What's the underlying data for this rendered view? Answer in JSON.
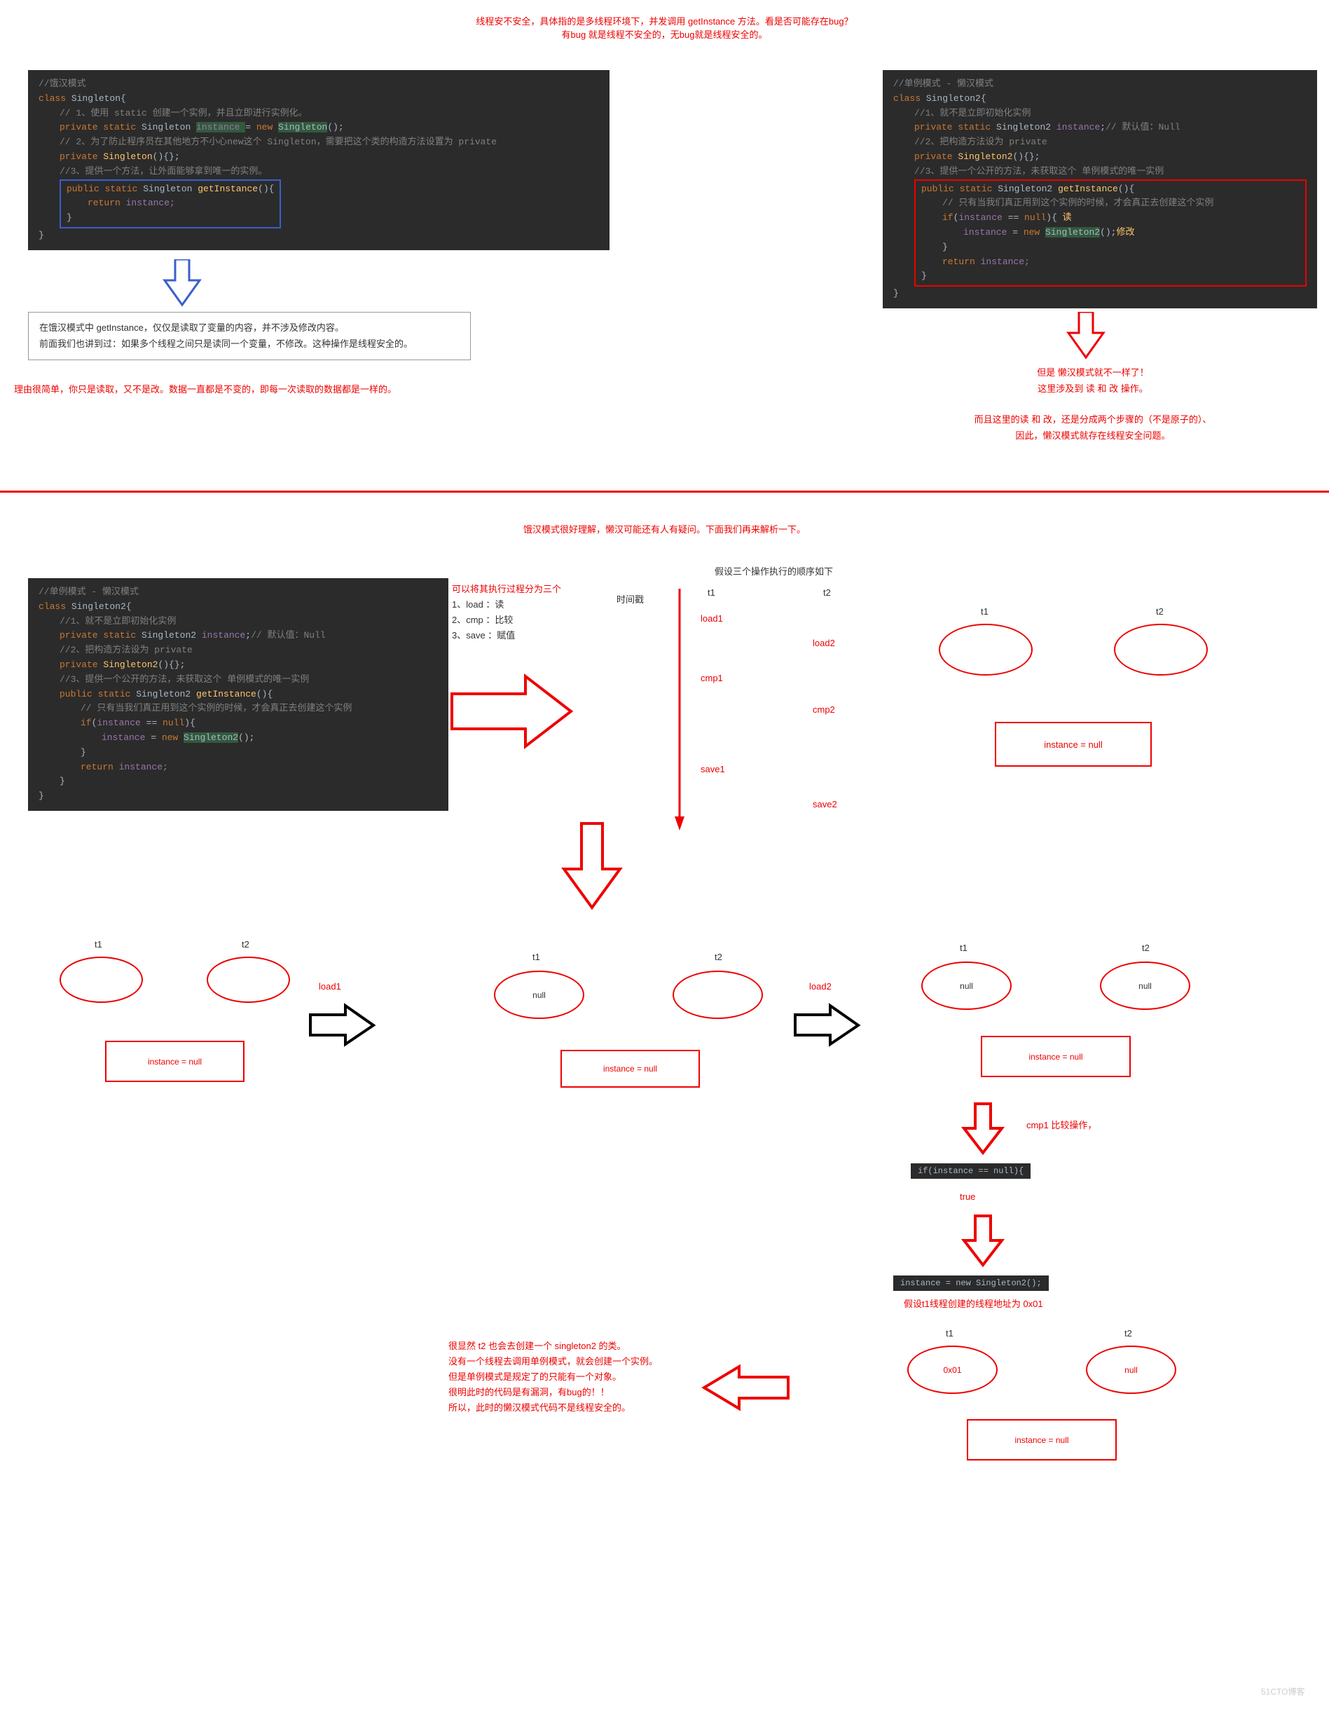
{
  "header": {
    "l1": "线程安不安全，具体指的是多线程环境下，并发调用 getInstance 方法。看是否可能存在bug？",
    "l2": "有bug 就是线程不安全的，无bug就是线程安全的。"
  },
  "code1": {
    "c0": "//饿汉模式",
    "c1a": "class ",
    "c1b": "Singleton",
    "c1c": "{",
    "c2": "// 1、使用 static 创建一个实例，并且立即进行实例化。",
    "c3a": "private ",
    "c3b": "static ",
    "c3c": "Singleton ",
    "c3d": "instance ",
    "c3e": "= ",
    "c3f": "new ",
    "c3g": "Singleton",
    "c3h": "();",
    "c4": "// 2、为了防止程序员在其他地方不小心new这个 Singleton，需要把这个类的构造方法设置为 private",
    "c5a": "private ",
    "c5b": "Singleton",
    "c5c": "(){};",
    "c6": "//3、提供一个方法，让外面能够拿到唯一的实例。",
    "c7a": "public static ",
    "c7b": "Singleton ",
    "c7c": "getInstance",
    "c7d": "(){",
    "c8a": "return ",
    "c8b": "instance;",
    "c9": "}",
    "c10": "}"
  },
  "code2": {
    "c0": "//单例模式 - 懒汉模式",
    "c1a": "class ",
    "c1b": "Singleton2",
    "c1c": "{",
    "c2": "//1、就不是立即初始化实例",
    "c3a": "private static ",
    "c3b": "Singleton2 ",
    "c3c": "instance",
    "c3d": ";",
    "c3e": "// 默认值：Null",
    "c4": "//2、把构造方法设为 private",
    "c5a": "private ",
    "c5b": "Singleton2",
    "c5c": "(){};",
    "c6": "//3、提供一个公开的方法，未获取这个 单例模式的唯一实例",
    "c7a": "public static ",
    "c7b": "Singleton2 ",
    "c7c": "getInstance",
    "c7d": "(){",
    "c8": "// 只有当我们真正用到这个实例的时候，才会真正去创建这个实例",
    "c9a": "if",
    "c9b": "(",
    "c9c": "instance ",
    "c9d": "== ",
    "c9e": "null",
    "c9f": "){ ",
    "c9g": "读",
    "c10a": "instance ",
    "c10b": "= ",
    "c10c": "new ",
    "c10d": "Singleton2",
    "c10e": "();",
    "c10f": "修改",
    "c11": "}",
    "c12a": "return ",
    "c12b": "instance;",
    "c13": "}",
    "c14": "}"
  },
  "box1": {
    "l1": "在饿汉模式中 getInstance，仅仅是读取了变量的内容，并不涉及修改内容。",
    "l2": "前面我们也讲到过：如果多个线程之间只是读同一个变量，不修改。这种操作是线程安全的。"
  },
  "reason1": "理由很简单，你只是读取，又不是改。数据一直都是不变的，即每一次读取的数据都是一样的。",
  "right_text": {
    "l1": "但是 懒汉模式就不一样了！",
    "l2": "这里涉及到 读 和 改 操作。",
    "l3": "而且这里的读 和 改，还是分成两个步骤的（不是原子的）、",
    "l4": "因此，懒汉模式就存在线程安全问题。"
  },
  "sec2_header": "饿汉模式很好理解，懒汉可能还有人有疑问。下面我们再来解析一下。",
  "code3": {
    "c0": "//单例模式 - 懒汉模式",
    "c1a": "class ",
    "c1b": "Singleton2",
    "c1c": "{",
    "c2": "//1、就不是立即初始化实例",
    "c3a": "private static ",
    "c3b": "Singleton2 ",
    "c3c": "instance",
    "c3d": ";",
    "c3e": "// 默认值：Null",
    "c4": "//2、把构造方法设为 private",
    "c5a": "private ",
    "c5b": "Singleton2",
    "c5c": "(){};",
    "c6": "//3、提供一个公开的方法，未获取这个 单例模式的唯一实例",
    "c7a": "public static ",
    "c7b": "Singleton2 ",
    "c7c": "getInstance",
    "c7d": "(){",
    "c8": "// 只有当我们真正用到这个实例的时候，才会真正去创建这个实例",
    "c9a": "if",
    "c9b": "(",
    "c9c": "instance ",
    "c9d": "== ",
    "c9e": "null",
    "c9f": "){",
    "c10a": "instance ",
    "c10b": "= ",
    "c10c": "new ",
    "c10d": "Singleton2",
    "c10e": "();",
    "c11": "}",
    "c12a": "return ",
    "c12b": "instance;",
    "c13": "}",
    "c14": "}"
  },
  "steps": {
    "title": "可以将其执行过程分为三个",
    "s1": "1、load ：读",
    "s2": "2、cmp ：比较",
    "s3": "3、save ：赋值"
  },
  "timeline": {
    "title": "假设三个操作执行的顺序如下",
    "time_label": "时间戳",
    "t1": "t1",
    "t2": "t2",
    "load1": "load1",
    "load2": "load2",
    "cmp1": "cmp1",
    "cmp2": "cmp2",
    "save1": "save1",
    "save2": "save2"
  },
  "state": {
    "t1": "t1",
    "t2": "t2",
    "inst_null": "instance = null",
    "null": "null"
  },
  "flow": {
    "load1": "load1",
    "load2": "load2",
    "cmp1_label": "cmp1 比较操作，",
    "true": "true",
    "if_code_a": "if(",
    "if_code_b": "instance ",
    "if_code_c": "== ",
    "if_code_d": "null",
    "if_code_e": "){",
    "new_code_a": "instance ",
    "new_code_b": "= ",
    "new_code_c": "new ",
    "new_code_d": "Singleton2",
    "new_code_e": "();",
    "addr": "假设t1线程创建的线程地址为 0x01",
    "val_0x01": "0x01"
  },
  "conclusion": {
    "l1": "很显然 t2 也会去创建一个 singleton2 的类。",
    "l2": "没有一个线程去调用单例模式，就会创建一个实例。",
    "l3": "但是单例模式是规定了的只能有一个对象。",
    "l4": "很明此时的代码是有漏洞，有bug的！！",
    "l5": "所以，此时的懒汉模式代码不是线程安全的。"
  },
  "watermark": "51CTO博客"
}
